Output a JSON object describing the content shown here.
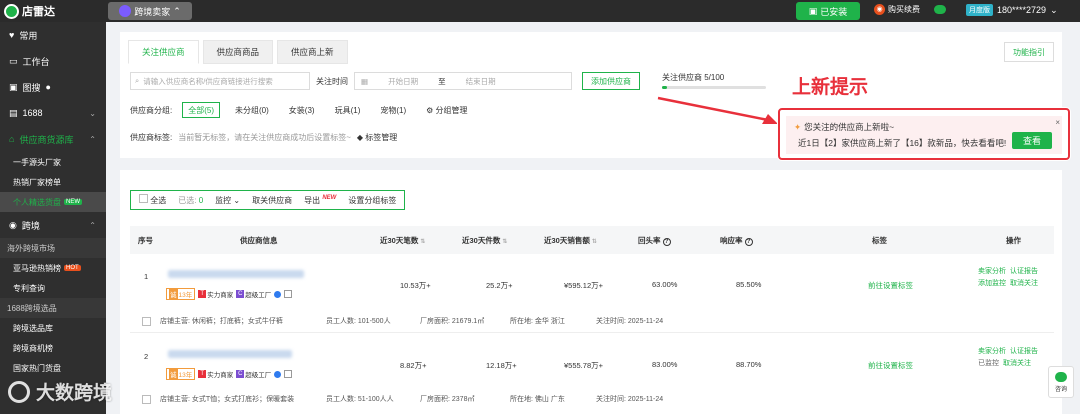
{
  "topbar": {
    "logo_text": "店雷达",
    "cross_seller_label": "跨境卖家",
    "installed_label": "已安装",
    "renew_label": "购买续费",
    "member_badge": "月度版",
    "phone": "180****2729"
  },
  "sidebar": {
    "items": [
      {
        "label": "常用",
        "icon": "heart-icon"
      },
      {
        "label": "工作台",
        "icon": "monitor-icon"
      },
      {
        "label": "图搜",
        "icon": "image-icon"
      },
      {
        "label": "1688",
        "icon": "box-icon"
      },
      {
        "label": "供应商货源库",
        "icon": "store-icon"
      }
    ],
    "sub_items": [
      "一手源头厂家",
      "热销厂家榜单",
      "个人精选货盘"
    ],
    "new_tag": "NEW",
    "cross_label": "跨境",
    "overseas_group": "海外跨境市场",
    "overseas_items": [
      "亚马逊热销榜",
      "专利查询"
    ],
    "hot_tag": "HOT",
    "selection_group": "1688跨境选品",
    "selection_items": [
      "跨境选品库",
      "跨境商机榜",
      "国家热门货盘"
    ]
  },
  "tabs": [
    "关注供应商",
    "供应商商品",
    "供应商上新"
  ],
  "guide_label": "功能指引",
  "filters": {
    "search_placeholder": "请输入供应商名称/供应商链接进行搜索",
    "follow_time_label": "关注时间",
    "start_date_placeholder": "开始日期",
    "date_separator": "至",
    "end_date_placeholder": "结束日期",
    "add_supplier_label": "添加供应商",
    "quota_text": "关注供应商 5/100",
    "quota_fraction": 0.05,
    "group_label": "供应商分组:",
    "groups": [
      "全部(5)",
      "未分组(0)",
      "女装(3)",
      "玩具(1)",
      "宠物(1)"
    ],
    "group_manage_label": "分组管理",
    "tag_label": "供应商标签:",
    "tag_empty": "当前暂无标签，请在关注供应商成功后设置标签~",
    "tag_manage_label": "标签管理"
  },
  "callout": "上新提示",
  "popup": {
    "title": "您关注的供应商上新啦~",
    "body": "近1日【2】家供应商上新了【16】款新品，快去看看吧!",
    "close": "×",
    "view_label": "查看"
  },
  "toolbar": {
    "select_all": "全选",
    "selected_prefix": "已选:",
    "selected_count": "0",
    "monitor": "监控",
    "unfollow": "取关供应商",
    "export": "导出",
    "export_badge": "NEW",
    "set_group_tag": "设置分组标签"
  },
  "table": {
    "headers": [
      "序号",
      "供应商信息",
      "近30天笔数",
      "近30天件数",
      "近30天销售额",
      "回头率",
      "响应率",
      "标签",
      "操作"
    ],
    "rows": [
      {
        "index": "1",
        "years": "13年",
        "badge_strength": "实力商家",
        "badge_super": "超级工厂",
        "orders": "10.53万+",
        "pieces": "25.2万+",
        "sales": "¥595.12万+",
        "repeat": "63.00%",
        "response": "85.50%",
        "tag_link": "前往设置标签",
        "ops": [
          "卖家分析",
          "认证报告",
          "添加监控",
          "取消关注"
        ],
        "main_business": "店铺主营:  休闲裤；打底裤；女式牛仔裤",
        "staff": "员工人数:  101-500人",
        "area": "厂房面积:  21679.1㎡",
        "location": "所在地:  金华 浙江",
        "follow_time": "关注时间:  2025-11-24"
      },
      {
        "index": "2",
        "years": "13年",
        "badge_strength": "实力商家",
        "badge_super": "超级工厂",
        "orders": "8.82万+",
        "pieces": "12.18万+",
        "sales": "¥555.78万+",
        "repeat": "83.00%",
        "response": "88.70%",
        "tag_link": "前往设置标签",
        "ops": [
          "卖家分析",
          "认证报告",
          "已监控",
          "取消关注"
        ],
        "main_business": "店铺主营:  女式T恤；女式打底衫；保暖套装",
        "staff": "员工人数:  51-100人人",
        "area": "厂房面积:  2378㎡",
        "location": "所在地:  佛山 广东",
        "follow_time": "关注时间:  2025-11-24"
      }
    ]
  },
  "watermark": "大数跨境",
  "chat_label": "咨询",
  "colors": {
    "brand_green": "#1fb34a",
    "alert_red": "#e8303b",
    "orange": "#f29b3c"
  }
}
